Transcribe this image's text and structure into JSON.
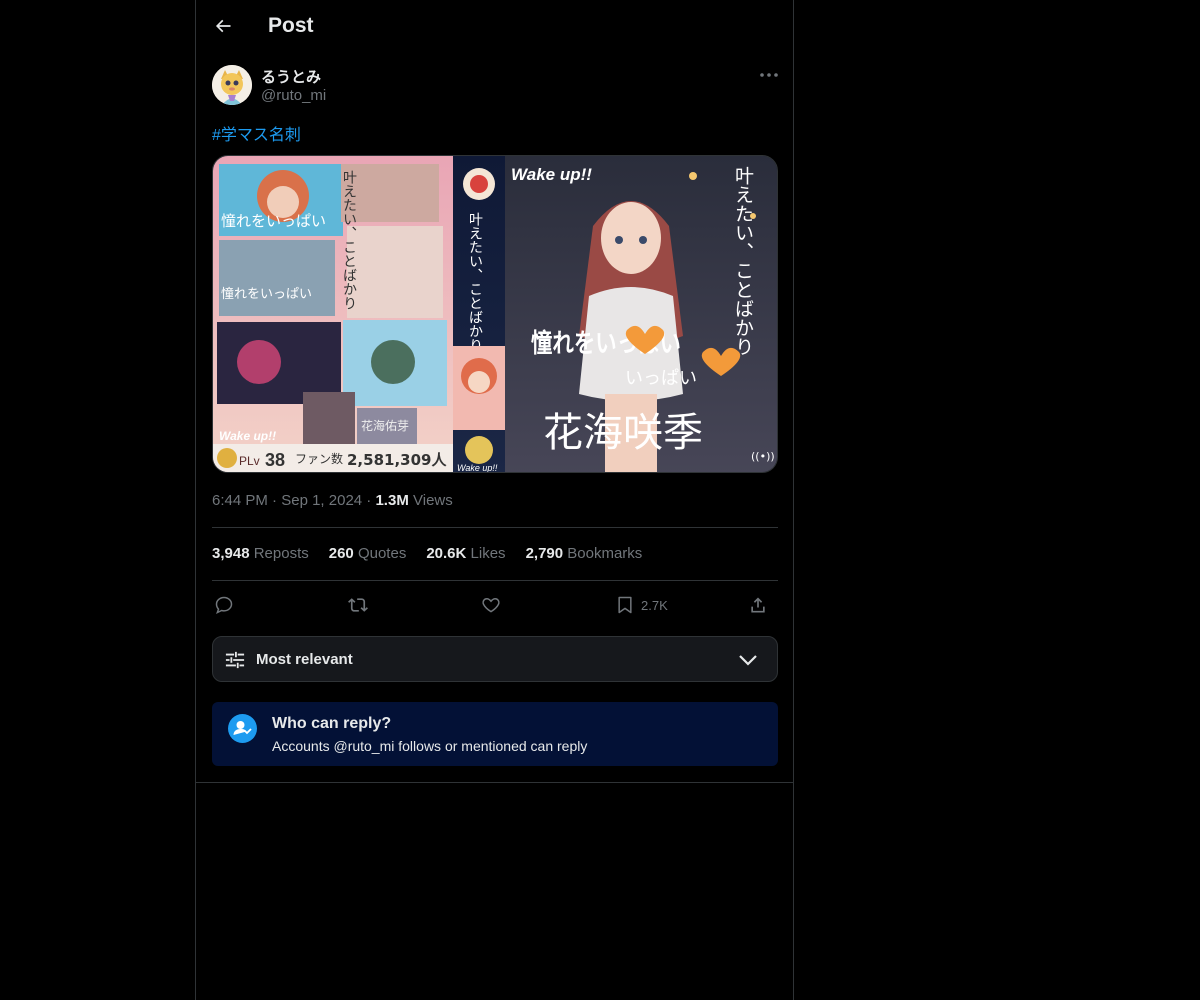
{
  "header": {
    "title": "Post"
  },
  "author": {
    "name": "るうとみ",
    "handle": "@ruto_mi"
  },
  "post": {
    "hashtag": "#学マス名刺",
    "time": "6:44 PM",
    "sep1": "·",
    "date": "Sep 1, 2024",
    "sep2": "·",
    "views_count": "1.3M",
    "views_label": "Views"
  },
  "media": {
    "text_vertical_1": "叶えたい、ことばかり",
    "text_vertical_2": "叶えたい、ことばかり",
    "wakeup": "Wake up!!",
    "wakeup_small": "Wake up!!",
    "wakeup_small_2": "Wake up!!",
    "akogare": "憧れをいっぱい",
    "akogare_small": "憧れをいっぱい",
    "akogare_small_2": "憧れをいっぱい",
    "ippai": "いっぱい",
    "signature": "花海咲季",
    "plv_label": "PLv",
    "plv_value": "38",
    "fans_label": "ファン数",
    "fans_value": "2,581,309人",
    "mini_sign": "花海佑芽"
  },
  "stats": {
    "reposts_count": "3,948",
    "reposts_label": "Reposts",
    "quotes_count": "260",
    "quotes_label": "Quotes",
    "likes_count": "20.6K",
    "likes_label": "Likes",
    "bookmarks_count": "2,790",
    "bookmarks_label": "Bookmarks"
  },
  "actions": {
    "bookmark_count": "2.7K"
  },
  "sort": {
    "label": "Most relevant"
  },
  "reply": {
    "title": "Who can reply?",
    "subtitle": "Accounts @ruto_mi follows or mentioned can reply"
  },
  "colors": {
    "accent": "#1d9bf0",
    "background": "#000000",
    "border": "#2f3336",
    "muted": "#71767b",
    "reply_box": "#031136"
  }
}
